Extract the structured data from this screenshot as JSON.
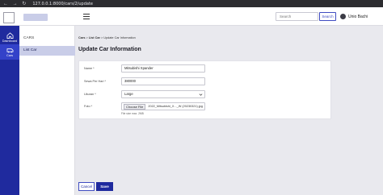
{
  "browser": {
    "nav_glyphs": "← → ↻",
    "url": "127.0.0.1:8000/cars/2/update"
  },
  "header": {
    "search_placeholder": "Search",
    "search_button": "Search",
    "user_name": "Unio Bachi"
  },
  "rail": {
    "items": [
      {
        "label": "Dashboard",
        "icon": "home-icon"
      },
      {
        "label": "Cars",
        "icon": "car-icon"
      }
    ]
  },
  "sidebar": {
    "title": "CARS",
    "items": [
      {
        "label": "List Car"
      }
    ]
  },
  "breadcrumb": {
    "root": "Cars",
    "sep1": ">",
    "list": "List Car",
    "sep2": ">",
    "current": "Update Car Information"
  },
  "page_title": "Update Car Information",
  "form": {
    "name_label": "Name *",
    "name_value": "Mitsubishi Xpander",
    "price_label": "Sewa Per Hari *",
    "price_value": "380000",
    "size_label": "Ukuran *",
    "size_value": "Large",
    "photo_label": "Foto *",
    "choose_label": "Choose File",
    "file_name": "2022_Mitsubishi_X..._W (20230321).jpg",
    "hint": "File size max. 2MB"
  },
  "actions": {
    "cancel": "Cancel",
    "save": "Save"
  },
  "colors": {
    "primary": "#1f2a9e",
    "accent_light": "#c9cde8"
  }
}
